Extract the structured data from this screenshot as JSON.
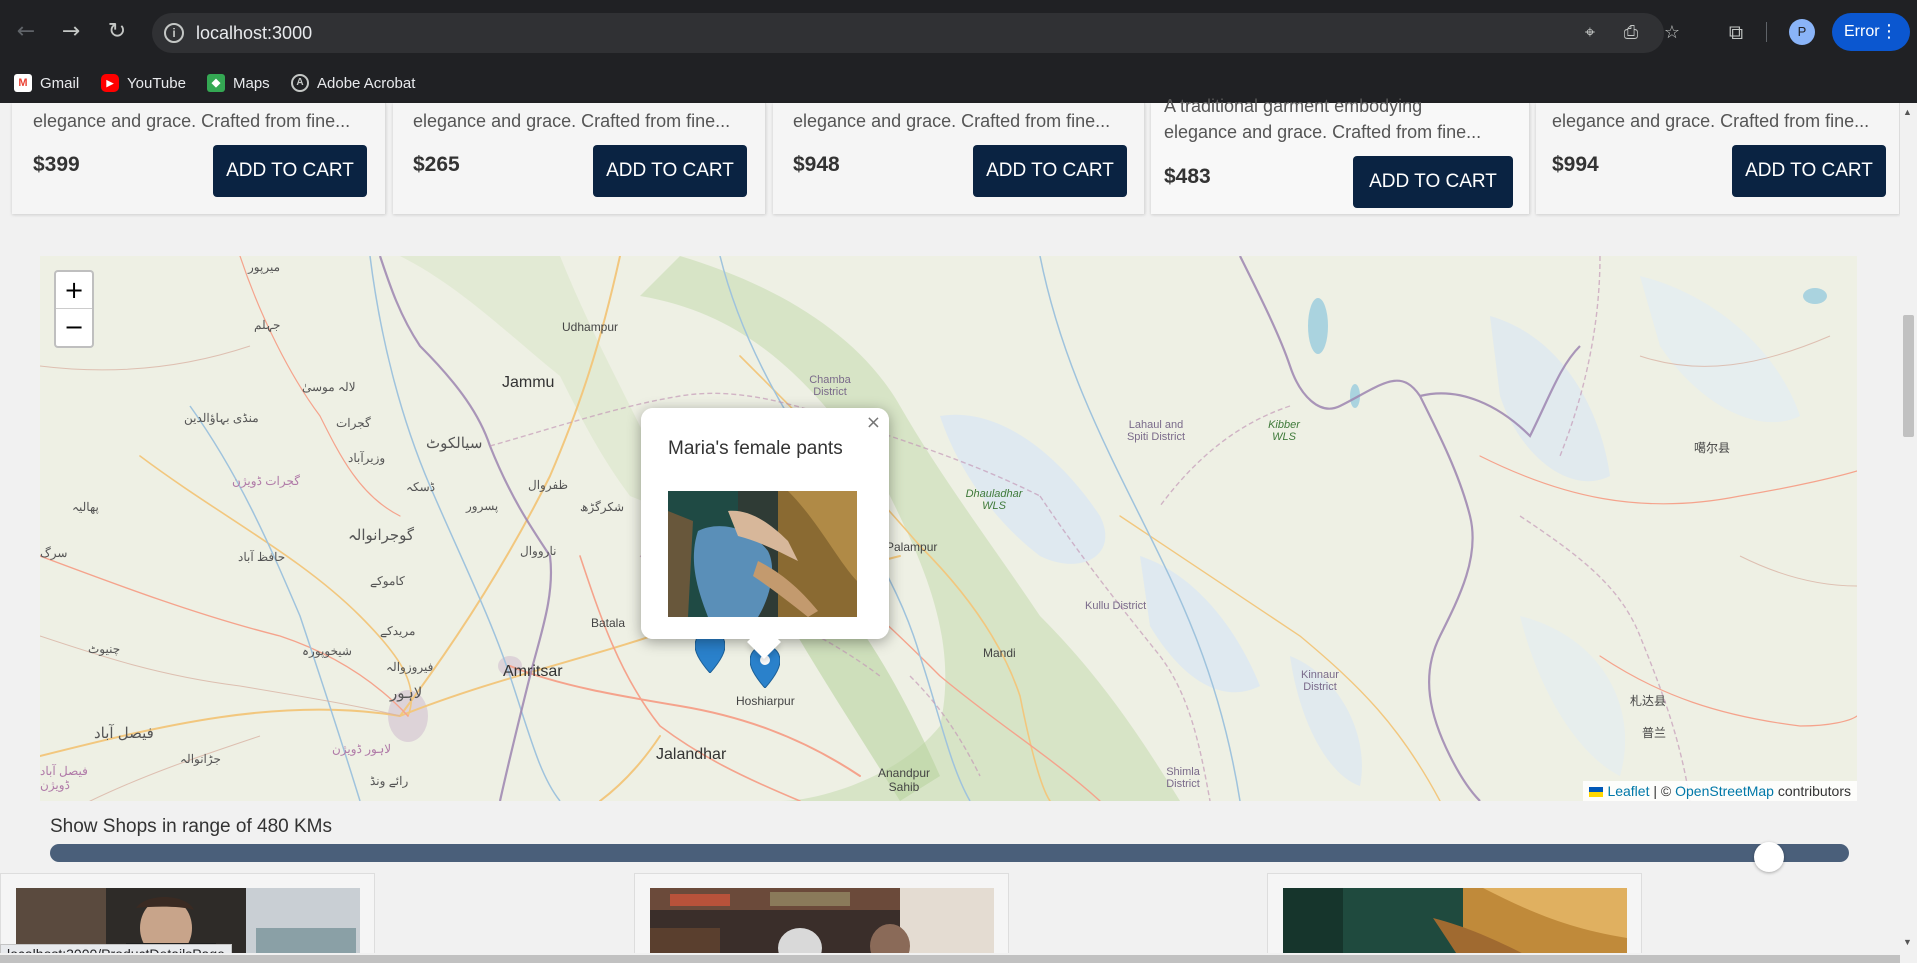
{
  "browser": {
    "url": "localhost:3000",
    "profile_initial": "P",
    "error_label": "Error",
    "bookmarks": [
      {
        "label": "Gmail",
        "icon": "gmail-icon"
      },
      {
        "label": "YouTube",
        "icon": "youtube-icon"
      },
      {
        "label": "Maps",
        "icon": "maps-icon"
      },
      {
        "label": "Adobe Acrobat",
        "icon": "acrobat-icon"
      }
    ]
  },
  "products": [
    {
      "desc": "elegance and grace. Crafted from fine...",
      "price": "$399",
      "button": "ADD TO CART"
    },
    {
      "desc": "elegance and grace. Crafted from fine...",
      "price": "$265",
      "button": "ADD TO CART"
    },
    {
      "desc": "elegance and grace. Crafted from fine...",
      "price": "$948",
      "button": "ADD TO CART"
    },
    {
      "desc_line1": "A traditional garment embodying",
      "desc": "elegance and grace. Crafted from fine...",
      "price": "$483",
      "button": "ADD TO CART"
    },
    {
      "desc": "elegance and grace. Crafted from fine...",
      "price": "$994",
      "button": "ADD TO CART"
    }
  ],
  "map": {
    "zoom_in": "+",
    "zoom_out": "−",
    "popup": {
      "title": "Maria's female pants",
      "close": "×"
    },
    "attribution": {
      "leaflet": "Leaflet",
      "sep": " | © ",
      "osm": "OpenStreetMap",
      "suffix": " contributors"
    },
    "labels": {
      "udhampur": "Udhampur",
      "jammu": "Jammu",
      "chamba": "Chamba District",
      "lahaul": "Lahaul and Spiti District",
      "kibber": "Kibber WLS",
      "dhauladhar": "Dhauladhar WLS",
      "palampur": "Palampur",
      "kullu": "Kullu District",
      "mandi": "Mandi",
      "kinnaur": "Kinnaur District",
      "batala": "Batala",
      "amritsar": "Amritsar",
      "hoshiarpur": "Hoshiarpur",
      "jalandhar": "Jalandhar",
      "anandpur": "Anandpur Sahib",
      "shimla": "Shimla District",
      "sialkot": "سیالکوٹ",
      "gujranwala": "گوجرانوالہ",
      "sheikhupura": "شیخوپورہ",
      "lahore": "لاہور",
      "faisalabad": "فیصل آباد",
      "mirpur": "میرپور",
      "jhelum": "جہلم",
      "lalamusa": "لالہ موسیٰ",
      "mandi_bahauddin": "منڈی بہاؤالدین",
      "gujrat": "گجرات",
      "gujrat_div": "گجرات ڈویژن",
      "wazirabad": "وزیرآباد",
      "daska": "ڈسکہ",
      "pasrur": "پسرور",
      "zafarwal": "ظفروال",
      "shakargarh": "شکرگڑھ",
      "narowal": "نارووال",
      "phalia": "پھالیہ",
      "hafizabad": "حافظ آباد",
      "kamoke": "کاموکے",
      "muridke": "مریدکے",
      "ferozwala": "فیروزوالہ",
      "chiniot": "چنیوٹ",
      "sargodha": "سرگ",
      "jaranwala": "جڑانوالہ",
      "lahore_div": "لاہور ڈویژن",
      "raiwind": "رائے ونڈ",
      "faisalabad_div": "فیصل آباد ڈویژن",
      "ngari": "噶尔县",
      "zhada": "札达县",
      "pulan": "普兰"
    }
  },
  "range": {
    "label": "Show Shops in range of 480 KMs",
    "value_km": 480,
    "max_km": 500
  },
  "status_url": "localhost:3000/ProductDetailsPage",
  "colors": {
    "accent": "#0a2342",
    "track": "#4a5f7a",
    "marker": "#2a81cb",
    "error_pill": "#0b57d0"
  }
}
